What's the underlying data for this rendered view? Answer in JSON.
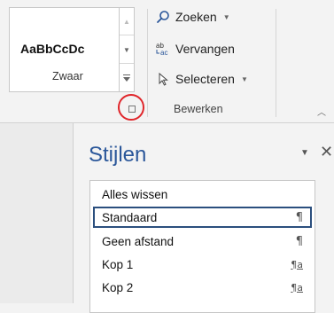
{
  "ribbon": {
    "styles_gallery": {
      "preview_text": "AaBbCcDc",
      "style_name": "Zwaar"
    },
    "editing_group": {
      "label": "Bewerken",
      "commands": [
        {
          "id": "find",
          "label": "Zoeken",
          "icon": "search-icon",
          "has_dropdown": true
        },
        {
          "id": "replace",
          "label": "Vervangen",
          "icon": "replace-icon",
          "has_dropdown": false
        },
        {
          "id": "select",
          "label": "Selecteren",
          "icon": "select-cursor-icon",
          "has_dropdown": true
        }
      ]
    },
    "highlight_color": "#e0262b"
  },
  "styles_pane": {
    "title": "Stijlen",
    "title_color": "#2b579a",
    "clear_all_label": "Alles wissen",
    "items": [
      {
        "label": "Standaard",
        "marker": "¶",
        "selected": true
      },
      {
        "label": "Geen afstand",
        "marker": "¶",
        "selected": false
      },
      {
        "label": "Kop 1",
        "marker": "¶a",
        "selected": false
      },
      {
        "label": "Kop 2",
        "marker": "¶a",
        "selected": false
      }
    ]
  }
}
